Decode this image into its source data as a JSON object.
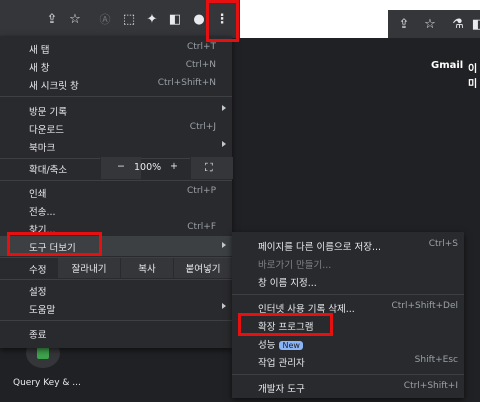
{
  "page": {
    "header_links": [
      "Gmail",
      "이미"
    ],
    "shortcut_label": "Query Key & ..."
  },
  "menu": {
    "new_tab": {
      "label": "새 탭",
      "shortcut": "Ctrl+T"
    },
    "new_window": {
      "label": "새 창",
      "shortcut": "Ctrl+N"
    },
    "new_incognito": {
      "label": "새 시크릿 창",
      "shortcut": "Ctrl+Shift+N"
    },
    "history": {
      "label": "방문 기록"
    },
    "downloads": {
      "label": "다운로드",
      "shortcut": "Ctrl+J"
    },
    "bookmarks": {
      "label": "북마크"
    },
    "zoom": {
      "label": "확대/축소",
      "minus": "−",
      "value": "100%",
      "plus": "+"
    },
    "print": {
      "label": "인쇄",
      "shortcut": "Ctrl+P"
    },
    "cast": {
      "label": "전송..."
    },
    "find": {
      "label": "찾기...",
      "shortcut": "Ctrl+F"
    },
    "more_tools": {
      "label": "도구 더보기"
    },
    "edit": {
      "label": "수정",
      "cut": "잘라내기",
      "copy": "복사",
      "paste": "붙여넣기"
    },
    "settings": {
      "label": "설정"
    },
    "help": {
      "label": "도움말"
    },
    "exit": {
      "label": "종료"
    }
  },
  "submenu": {
    "save_page": {
      "label": "페이지를 다른 이름으로 저장...",
      "shortcut": "Ctrl+S"
    },
    "create_shortcut": {
      "label": "바로가기 만들기..."
    },
    "name_window": {
      "label": "창 이름 지정..."
    },
    "clear_data": {
      "label": "인터넷 사용 기록 삭제...",
      "shortcut": "Ctrl+Shift+Del"
    },
    "extensions": {
      "label": "확장 프로그램"
    },
    "performance": {
      "label": "성능",
      "badge": "New"
    },
    "task_manager": {
      "label": "작업 관리자",
      "shortcut": "Shift+Esc"
    },
    "dev_tools": {
      "label": "개발자 도구",
      "shortcut": "Ctrl+Shift+I"
    }
  },
  "colors": {
    "highlight": "#e61010",
    "menu_bg": "#292a2d"
  }
}
